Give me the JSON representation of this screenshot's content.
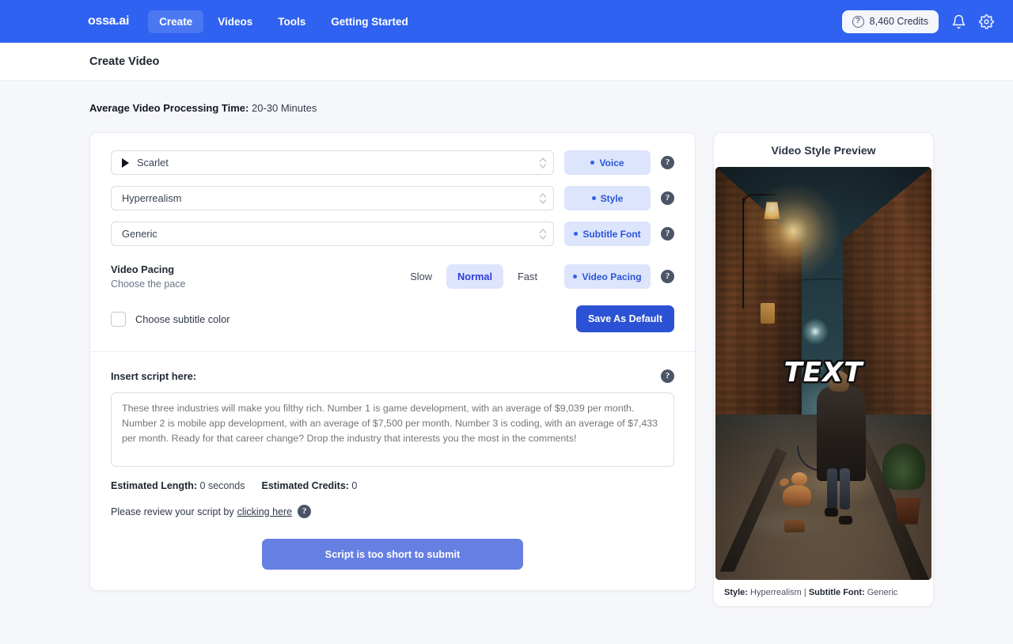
{
  "navbar": {
    "brand": "ossa.ai",
    "links": [
      {
        "label": "Create",
        "active": true
      },
      {
        "label": "Videos",
        "active": false
      },
      {
        "label": "Tools",
        "active": false
      },
      {
        "label": "Getting Started",
        "active": false
      }
    ],
    "credits": {
      "icon": "question-circle-icon",
      "label": "8,460 Credits"
    },
    "notification_icon": "bell-icon",
    "settings_icon": "gear-icon",
    "background_color": "#2f62f0"
  },
  "subheader": {
    "title": "Create Video"
  },
  "processing": {
    "label": "Average Video Processing Time:",
    "value": "20-30 Minutes"
  },
  "form": {
    "voice": {
      "value": "Scarlet",
      "badge": "Voice",
      "help": "?",
      "play_icon": "play-icon",
      "stepper_icon": "chevron-up-down-icon"
    },
    "style": {
      "value": "Hyperrealism",
      "badge": "Style",
      "help": "?",
      "stepper_icon": "chevron-up-down-icon"
    },
    "subtitle_font": {
      "value": "Generic",
      "badge": "Subtitle Font",
      "help": "?",
      "stepper_icon": "chevron-up-down-icon"
    },
    "pacing": {
      "title": "Video Pacing",
      "subtitle": "Choose the pace",
      "options": [
        {
          "label": "Slow",
          "selected": false
        },
        {
          "label": "Normal",
          "selected": true
        },
        {
          "label": "Fast",
          "selected": false
        }
      ],
      "badge": "Video Pacing",
      "help": "?"
    },
    "subtitle_color": {
      "label": "Choose subtitle color",
      "checked": false
    },
    "save_default_label": "Save As Default"
  },
  "script": {
    "label": "Insert script here:",
    "help": "?",
    "placeholder": "These three industries will make you filthy rich. Number 1 is game development, with an average of $9,039 per month. Number 2 is mobile app development, with an average of $7,500 per month. Number 3 is coding, with an average of $7,433 per month. Ready for that career change? Drop the industry that interests you the most in the comments!",
    "value": "",
    "estimated_length_label": "Estimated Length:",
    "estimated_length_value": "0 seconds",
    "estimated_credits_label": "Estimated Credits:",
    "estimated_credits_value": "0",
    "review_prefix": "Please review your script by",
    "review_link": "clicking here",
    "review_help": "?",
    "submit_label": "Script is too short to submit"
  },
  "preview": {
    "title": "Video Style Preview",
    "overlay_text": "TEXT",
    "footer_style_label": "Style:",
    "footer_style_value": "Hyperrealism",
    "footer_separator": "|",
    "footer_font_label": "Subtitle Font:",
    "footer_font_value": "Generic"
  },
  "colors": {
    "brand_blue": "#2f62f0",
    "badge_bg": "#dde5fd",
    "badge_text": "#2b55d8",
    "save_button": "#2b52d4",
    "submit_button": "#667fe2",
    "page_bg": "#f6f7fa"
  }
}
